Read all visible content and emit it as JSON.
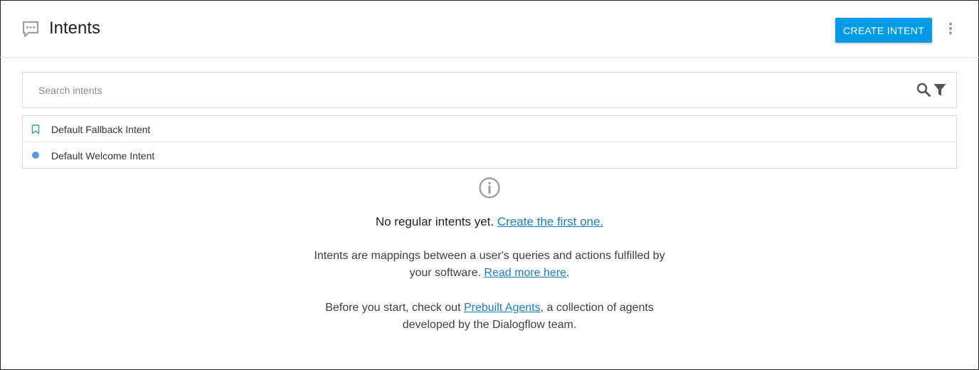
{
  "header": {
    "title": "Intents",
    "create_button_label": "CREATE INTENT",
    "icons": {
      "section": "chat-bubble-icon",
      "menu": "more-vert-icon"
    }
  },
  "search": {
    "placeholder": "Search intents",
    "value": "",
    "icons": {
      "search": "search-icon",
      "filter": "filter-icon"
    }
  },
  "intents": [
    {
      "name": "Default Fallback Intent",
      "icon": "bookmark-icon"
    },
    {
      "name": "Default Welcome Intent",
      "icon": "dot-icon"
    }
  ],
  "empty_state": {
    "icon": "info-icon",
    "title_text": "No regular intents yet.",
    "title_link": "Create the first one.",
    "para1_line1": "Intents are mappings between a user's queries and actions fulfilled by",
    "para1_line2_pre": "your software.",
    "para1_link": "Read more here",
    "para1_post": ".",
    "para2_pre": "Before you start, check out",
    "para2_link": "Prebuilt Agents",
    "para2_post": ", a collection of agents",
    "para2_line2": "developed by the Dialogflow team."
  },
  "colors": {
    "accent": "#039be5",
    "link": "#1a7dc4",
    "welcome_dot": "#5b9bd5",
    "fallback_icon": "#26a69a"
  }
}
